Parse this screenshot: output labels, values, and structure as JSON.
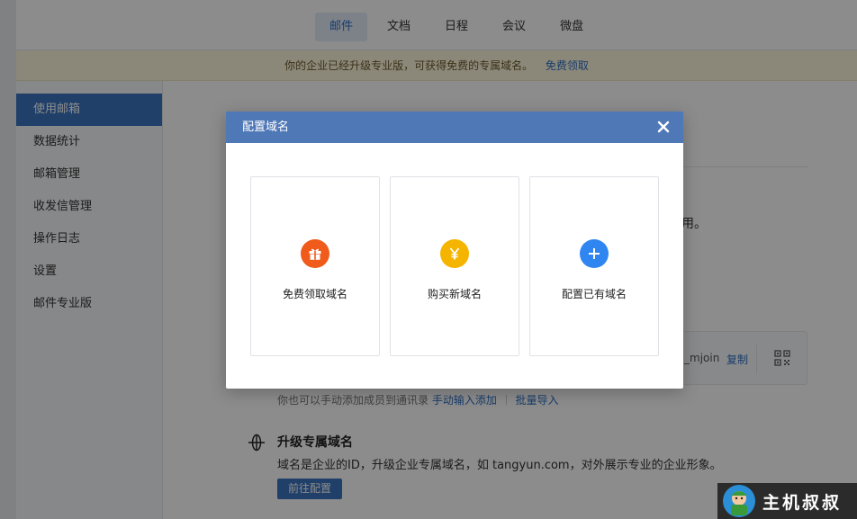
{
  "nav": {
    "tabs": [
      {
        "label": "邮件",
        "active": true
      },
      {
        "label": "文档",
        "active": false
      },
      {
        "label": "日程",
        "active": false
      },
      {
        "label": "会议",
        "active": false
      },
      {
        "label": "微盘",
        "active": false
      }
    ]
  },
  "banner": {
    "text": "你的企业已经升级专业版，可获得免费的专属域名。",
    "link": "免费领取"
  },
  "sidebar": {
    "items": [
      {
        "label": "使用邮箱",
        "active": true
      },
      {
        "label": "数据统计",
        "active": false
      },
      {
        "label": "邮箱管理",
        "active": false
      },
      {
        "label": "收发信管理",
        "active": false
      },
      {
        "label": "操作日志",
        "active": false
      },
      {
        "label": "设置",
        "active": false
      },
      {
        "label": "邮件专业版",
        "active": false
      }
    ]
  },
  "main": {
    "partial_text": "用。",
    "qr_card": {
      "handle": "_mjoin",
      "copy_label": "复制"
    },
    "hint": {
      "text": "你也可以手动添加成员到通讯录",
      "manual_link": "手动输入添加",
      "batch_link": "批量导入"
    },
    "upgrade": {
      "title": "升级专属域名",
      "desc": "域名是企业的ID，升级企业专属域名，如 tangyun.com，对外展示专业的企业形象。",
      "button": "前往配置"
    }
  },
  "modal": {
    "title": "配置域名",
    "options": [
      {
        "label": "免费领取域名",
        "icon": "gift-icon",
        "color": "#f05a1a"
      },
      {
        "label": "购买新域名",
        "icon": "yen-icon",
        "color": "#f5b400"
      },
      {
        "label": "配置已有域名",
        "icon": "plus-icon",
        "color": "#2f86f0"
      }
    ]
  },
  "watermark": {
    "text": "主机叔叔"
  },
  "colors": {
    "accent": "#3b73c0",
    "modal_header": "#4f78b7",
    "banner_bg": "#fdf7de"
  }
}
